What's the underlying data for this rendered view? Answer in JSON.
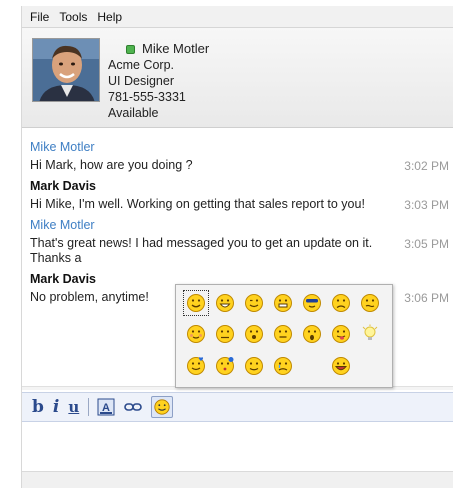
{
  "menu": [
    "File",
    "Tools",
    "Help"
  ],
  "contact": {
    "name": "Mike Motler",
    "company": "Acme Corp.",
    "title": "UI Designer",
    "phone": "781-555-3331",
    "status": "Available"
  },
  "messages": [
    {
      "sender": "Mike Motler",
      "text": "Hi Mark, how are you doing ?",
      "time": "3:02 PM"
    },
    {
      "sender": "Mark Davis",
      "text": "Hi Mike, I'm well. Working on getting that sales report to you!",
      "time": "3:03 PM"
    },
    {
      "sender": "Mike Motler",
      "text": "That's great news! I had messaged you to get an update on it. Thanks a",
      "time": "3:05 PM"
    },
    {
      "sender": "Mark Davis",
      "text": "No problem, anytime!",
      "time": "3:06 PM"
    }
  ],
  "toolbar": {
    "bold": "b",
    "italic": "i",
    "underline": "u",
    "font_color": "A"
  },
  "emoticons": [
    "smile",
    "grin",
    "wink",
    "teeth",
    "cool",
    "sad",
    "confused",
    "blush",
    "worried",
    "surprised",
    "neutral",
    "shocked",
    "tongue",
    "idea",
    "love",
    "kiss",
    "embarrassed",
    "cry",
    "laugh"
  ],
  "colors": {
    "accent": "#3f7fc4",
    "status_available": "#4fb34f",
    "toolbar_bg": "#eef2fa"
  }
}
